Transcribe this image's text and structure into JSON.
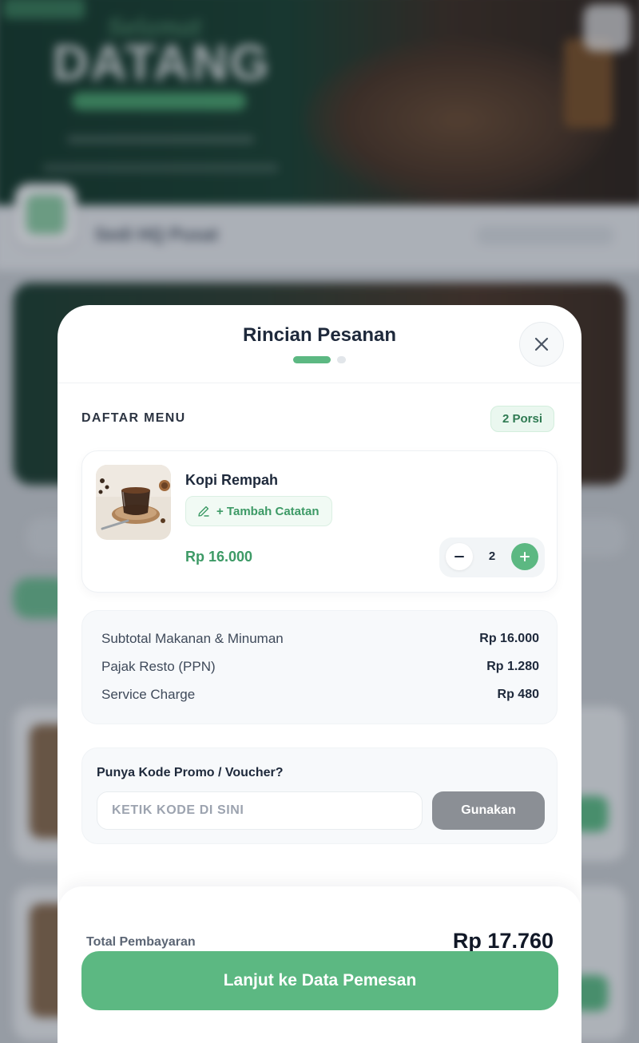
{
  "background": {
    "hero_title": "DATANG",
    "hero_script": "Selamat",
    "store_name": "Sedi HQ Pusat"
  },
  "modal": {
    "title": "Rincian Pesanan",
    "step_current": 1,
    "step_total": 2,
    "close_icon": "close-icon"
  },
  "menu_section": {
    "title": "DAFTAR MENU",
    "portion_badge": "2 Porsi"
  },
  "items": [
    {
      "name": "Kopi Rempah",
      "note_button": "+ Tambah Catatan",
      "note_icon": "pencil-icon",
      "price": "Rp 16.000",
      "quantity": "2"
    }
  ],
  "summary": {
    "rows": [
      {
        "label": "Subtotal Makanan & Minuman",
        "value": "Rp 16.000"
      },
      {
        "label": "Pajak Resto (PPN)",
        "value": "Rp 1.280"
      },
      {
        "label": "Service Charge",
        "value": "Rp 480"
      }
    ]
  },
  "promo": {
    "title": "Punya Kode Promo / Voucher?",
    "placeholder": "KETIK KODE DI SINI",
    "apply_label": "Gunakan"
  },
  "footer": {
    "total_label": "Total Pembayaran",
    "total_value": "Rp 17.760",
    "cta_label": "Lanjut ke Data Pemesan"
  },
  "colors": {
    "accent": "#5cb882",
    "accent_text": "#3d9a66",
    "disabled_button": "#8b8f95"
  }
}
